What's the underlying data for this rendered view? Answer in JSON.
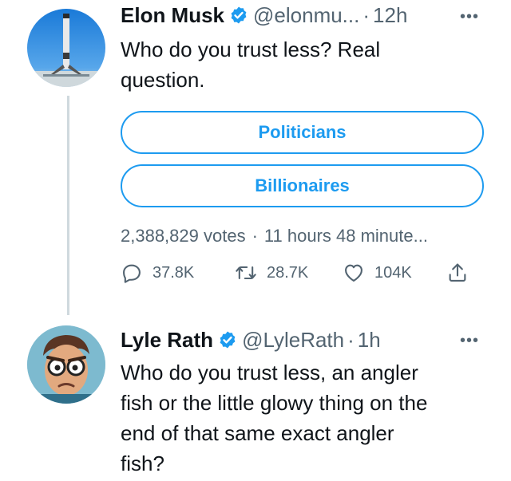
{
  "colors": {
    "accent": "#1d9bf0",
    "secondary_text": "#536471",
    "thread_line": "#cfd9de"
  },
  "tweet1": {
    "name": "Elon Musk",
    "handle": "@elonmu...",
    "separator": "·",
    "time": "12h",
    "more": "•••",
    "text_lines": [
      "Who do you trust less? Real",
      "question."
    ],
    "poll": {
      "options": [
        "Politicians",
        "Billionaires"
      ],
      "votes": "2,388,829 votes",
      "separator": "·",
      "remaining": "11 hours 48 minute..."
    },
    "actions": {
      "replies": "37.8K",
      "retweets": "28.7K",
      "likes": "104K"
    },
    "icons": [
      "verified-badge-icon",
      "reply-icon",
      "retweet-icon",
      "like-icon",
      "share-icon",
      "more-icon"
    ]
  },
  "tweet2": {
    "name": "Lyle Rath",
    "handle": "@LyleRath",
    "separator": "·",
    "time": "1h",
    "more": "•••",
    "text_lines": [
      "Who do you trust less, an angler",
      "fish or the little glowy thing on the",
      "end of that same exact angler",
      "fish?"
    ]
  }
}
